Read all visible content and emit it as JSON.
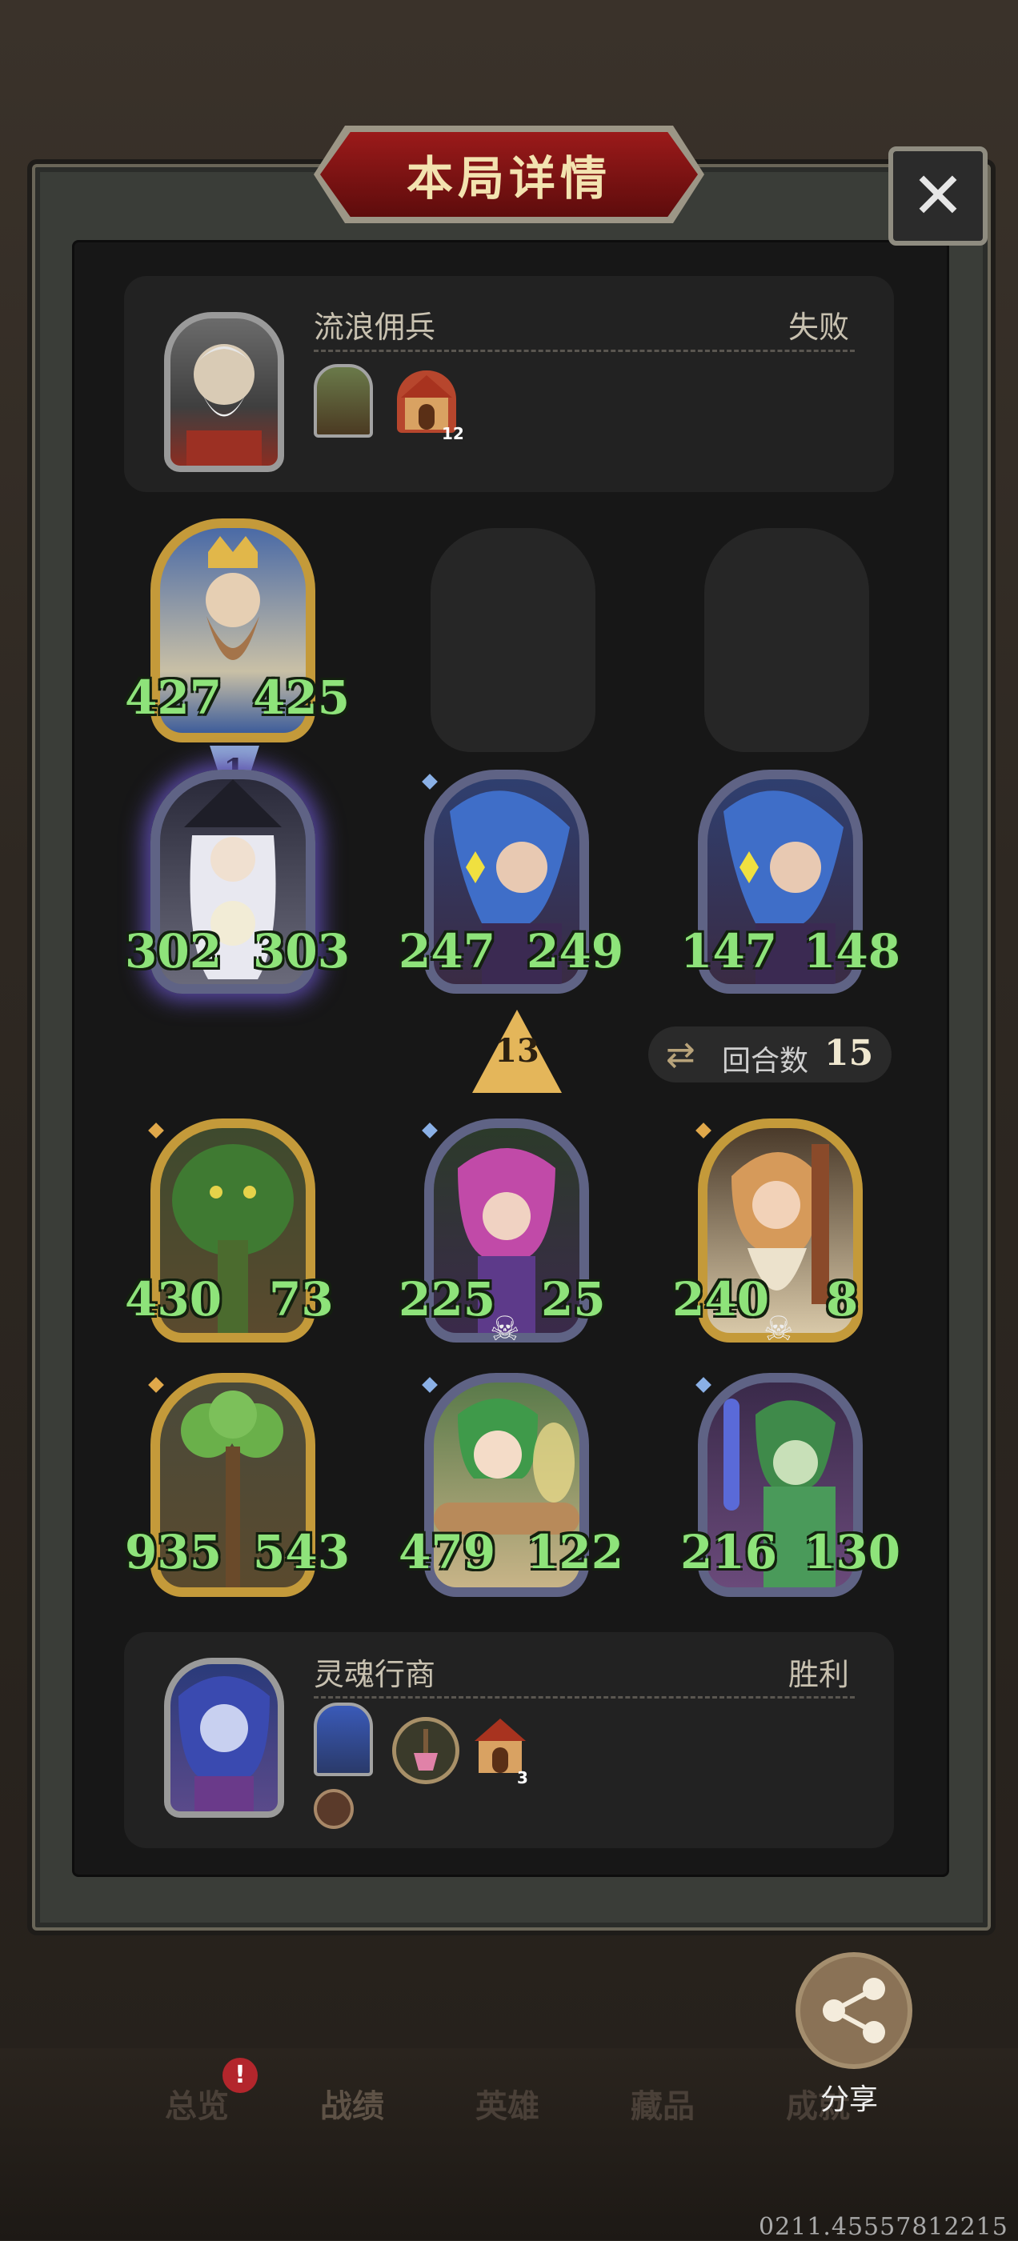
{
  "title": "本局详情",
  "close_label": "✕",
  "opponent": {
    "name": "流浪佣兵",
    "result": "失败",
    "house_count": "12"
  },
  "player": {
    "name": "灵魂行商",
    "result": "胜利",
    "house_count": "3"
  },
  "turn": {
    "label": "回合数",
    "value": "15"
  },
  "arrow_value": "13",
  "level_badge": "1",
  "opponent_board": [
    {
      "attack": "427",
      "health": "425"
    }
  ],
  "rows": [
    [
      {
        "attack": "302",
        "health": "303"
      },
      {
        "attack": "247",
        "health": "249"
      },
      {
        "attack": "147",
        "health": "148"
      }
    ],
    [
      {
        "attack": "430",
        "health": "73"
      },
      {
        "attack": "225",
        "health": "25"
      },
      {
        "attack": "240",
        "health": "8"
      }
    ],
    [
      {
        "attack": "935",
        "health": "543"
      },
      {
        "attack": "479",
        "health": "122"
      },
      {
        "attack": "216",
        "health": "130"
      }
    ]
  ],
  "share_label": "分享",
  "tabs": [
    "总览",
    "战绩",
    "英雄",
    "藏品",
    "成就"
  ],
  "notification_badge": "!",
  "version": "0211.45557812215",
  "colors": {
    "stat_green": "#8ee37a",
    "gold_frame": "#c49a3a",
    "purple_frame": "#5f6385",
    "title_red": "#9b1a1a"
  }
}
